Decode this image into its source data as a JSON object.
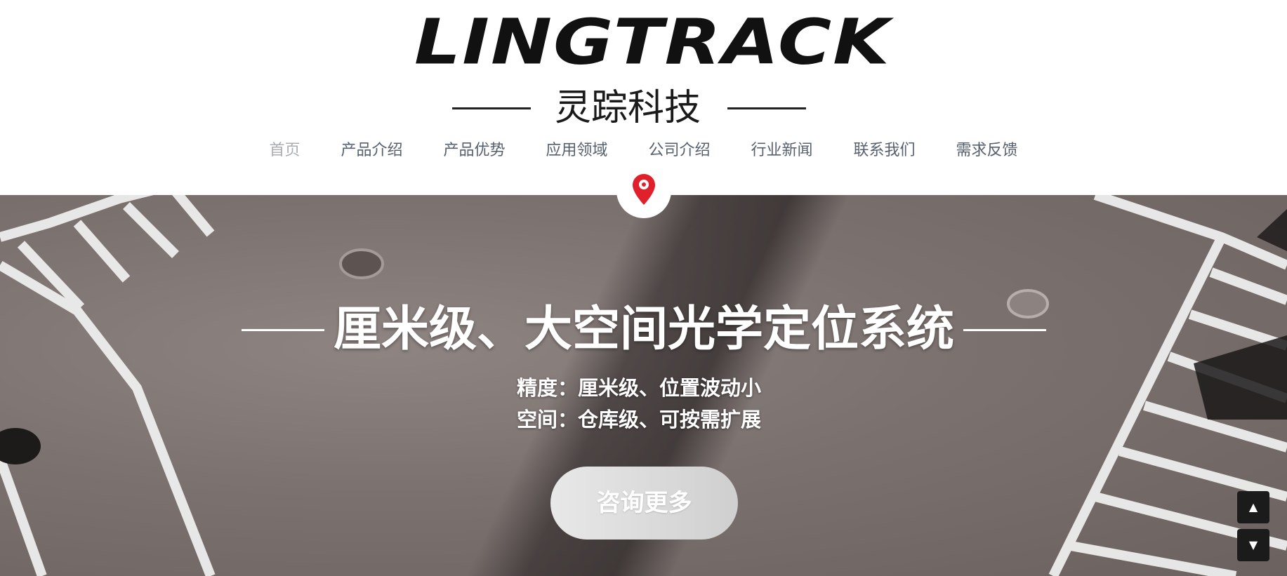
{
  "header": {
    "logo_text": "LINGTRACK",
    "logo_subtitle": "灵踪科技"
  },
  "nav": {
    "items": [
      {
        "label": "首页",
        "active": true
      },
      {
        "label": "产品介绍"
      },
      {
        "label": "产品优势"
      },
      {
        "label": "应用领域"
      },
      {
        "label": "公司介绍"
      },
      {
        "label": "行业新闻"
      },
      {
        "label": "联系我们"
      },
      {
        "label": "需求反馈"
      }
    ]
  },
  "hero": {
    "title": "厘米级、大空间光学定位系统",
    "line1": "精度：厘米级、位置波动小",
    "line2": "空间：仓库级、可按需扩展",
    "cta_label": "咨询更多"
  },
  "icons": {
    "pin": "map-pin-icon",
    "scroll_up": "triangle-up-icon",
    "scroll_down": "triangle-down-icon"
  },
  "colors": {
    "pin": "#e0202a",
    "nav_text": "#56606e",
    "nav_active": "#a9adb3",
    "scroll_button": "#1b1b1b"
  }
}
